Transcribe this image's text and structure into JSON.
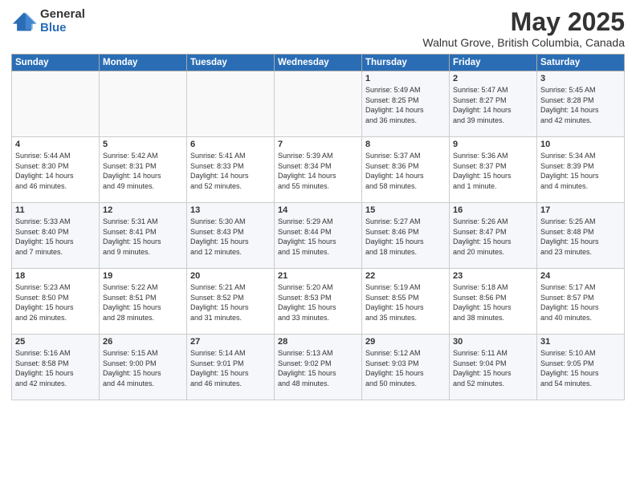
{
  "logo": {
    "general": "General",
    "blue": "Blue"
  },
  "title": "May 2025",
  "location": "Walnut Grove, British Columbia, Canada",
  "weekdays": [
    "Sunday",
    "Monday",
    "Tuesday",
    "Wednesday",
    "Thursday",
    "Friday",
    "Saturday"
  ],
  "weeks": [
    [
      {
        "day": "",
        "info": ""
      },
      {
        "day": "",
        "info": ""
      },
      {
        "day": "",
        "info": ""
      },
      {
        "day": "",
        "info": ""
      },
      {
        "day": "1",
        "info": "Sunrise: 5:49 AM\nSunset: 8:25 PM\nDaylight: 14 hours\nand 36 minutes."
      },
      {
        "day": "2",
        "info": "Sunrise: 5:47 AM\nSunset: 8:27 PM\nDaylight: 14 hours\nand 39 minutes."
      },
      {
        "day": "3",
        "info": "Sunrise: 5:45 AM\nSunset: 8:28 PM\nDaylight: 14 hours\nand 42 minutes."
      }
    ],
    [
      {
        "day": "4",
        "info": "Sunrise: 5:44 AM\nSunset: 8:30 PM\nDaylight: 14 hours\nand 46 minutes."
      },
      {
        "day": "5",
        "info": "Sunrise: 5:42 AM\nSunset: 8:31 PM\nDaylight: 14 hours\nand 49 minutes."
      },
      {
        "day": "6",
        "info": "Sunrise: 5:41 AM\nSunset: 8:33 PM\nDaylight: 14 hours\nand 52 minutes."
      },
      {
        "day": "7",
        "info": "Sunrise: 5:39 AM\nSunset: 8:34 PM\nDaylight: 14 hours\nand 55 minutes."
      },
      {
        "day": "8",
        "info": "Sunrise: 5:37 AM\nSunset: 8:36 PM\nDaylight: 14 hours\nand 58 minutes."
      },
      {
        "day": "9",
        "info": "Sunrise: 5:36 AM\nSunset: 8:37 PM\nDaylight: 15 hours\nand 1 minute."
      },
      {
        "day": "10",
        "info": "Sunrise: 5:34 AM\nSunset: 8:39 PM\nDaylight: 15 hours\nand 4 minutes."
      }
    ],
    [
      {
        "day": "11",
        "info": "Sunrise: 5:33 AM\nSunset: 8:40 PM\nDaylight: 15 hours\nand 7 minutes."
      },
      {
        "day": "12",
        "info": "Sunrise: 5:31 AM\nSunset: 8:41 PM\nDaylight: 15 hours\nand 9 minutes."
      },
      {
        "day": "13",
        "info": "Sunrise: 5:30 AM\nSunset: 8:43 PM\nDaylight: 15 hours\nand 12 minutes."
      },
      {
        "day": "14",
        "info": "Sunrise: 5:29 AM\nSunset: 8:44 PM\nDaylight: 15 hours\nand 15 minutes."
      },
      {
        "day": "15",
        "info": "Sunrise: 5:27 AM\nSunset: 8:46 PM\nDaylight: 15 hours\nand 18 minutes."
      },
      {
        "day": "16",
        "info": "Sunrise: 5:26 AM\nSunset: 8:47 PM\nDaylight: 15 hours\nand 20 minutes."
      },
      {
        "day": "17",
        "info": "Sunrise: 5:25 AM\nSunset: 8:48 PM\nDaylight: 15 hours\nand 23 minutes."
      }
    ],
    [
      {
        "day": "18",
        "info": "Sunrise: 5:23 AM\nSunset: 8:50 PM\nDaylight: 15 hours\nand 26 minutes."
      },
      {
        "day": "19",
        "info": "Sunrise: 5:22 AM\nSunset: 8:51 PM\nDaylight: 15 hours\nand 28 minutes."
      },
      {
        "day": "20",
        "info": "Sunrise: 5:21 AM\nSunset: 8:52 PM\nDaylight: 15 hours\nand 31 minutes."
      },
      {
        "day": "21",
        "info": "Sunrise: 5:20 AM\nSunset: 8:53 PM\nDaylight: 15 hours\nand 33 minutes."
      },
      {
        "day": "22",
        "info": "Sunrise: 5:19 AM\nSunset: 8:55 PM\nDaylight: 15 hours\nand 35 minutes."
      },
      {
        "day": "23",
        "info": "Sunrise: 5:18 AM\nSunset: 8:56 PM\nDaylight: 15 hours\nand 38 minutes."
      },
      {
        "day": "24",
        "info": "Sunrise: 5:17 AM\nSunset: 8:57 PM\nDaylight: 15 hours\nand 40 minutes."
      }
    ],
    [
      {
        "day": "25",
        "info": "Sunrise: 5:16 AM\nSunset: 8:58 PM\nDaylight: 15 hours\nand 42 minutes."
      },
      {
        "day": "26",
        "info": "Sunrise: 5:15 AM\nSunset: 9:00 PM\nDaylight: 15 hours\nand 44 minutes."
      },
      {
        "day": "27",
        "info": "Sunrise: 5:14 AM\nSunset: 9:01 PM\nDaylight: 15 hours\nand 46 minutes."
      },
      {
        "day": "28",
        "info": "Sunrise: 5:13 AM\nSunset: 9:02 PM\nDaylight: 15 hours\nand 48 minutes."
      },
      {
        "day": "29",
        "info": "Sunrise: 5:12 AM\nSunset: 9:03 PM\nDaylight: 15 hours\nand 50 minutes."
      },
      {
        "day": "30",
        "info": "Sunrise: 5:11 AM\nSunset: 9:04 PM\nDaylight: 15 hours\nand 52 minutes."
      },
      {
        "day": "31",
        "info": "Sunrise: 5:10 AM\nSunset: 9:05 PM\nDaylight: 15 hours\nand 54 minutes."
      }
    ]
  ]
}
